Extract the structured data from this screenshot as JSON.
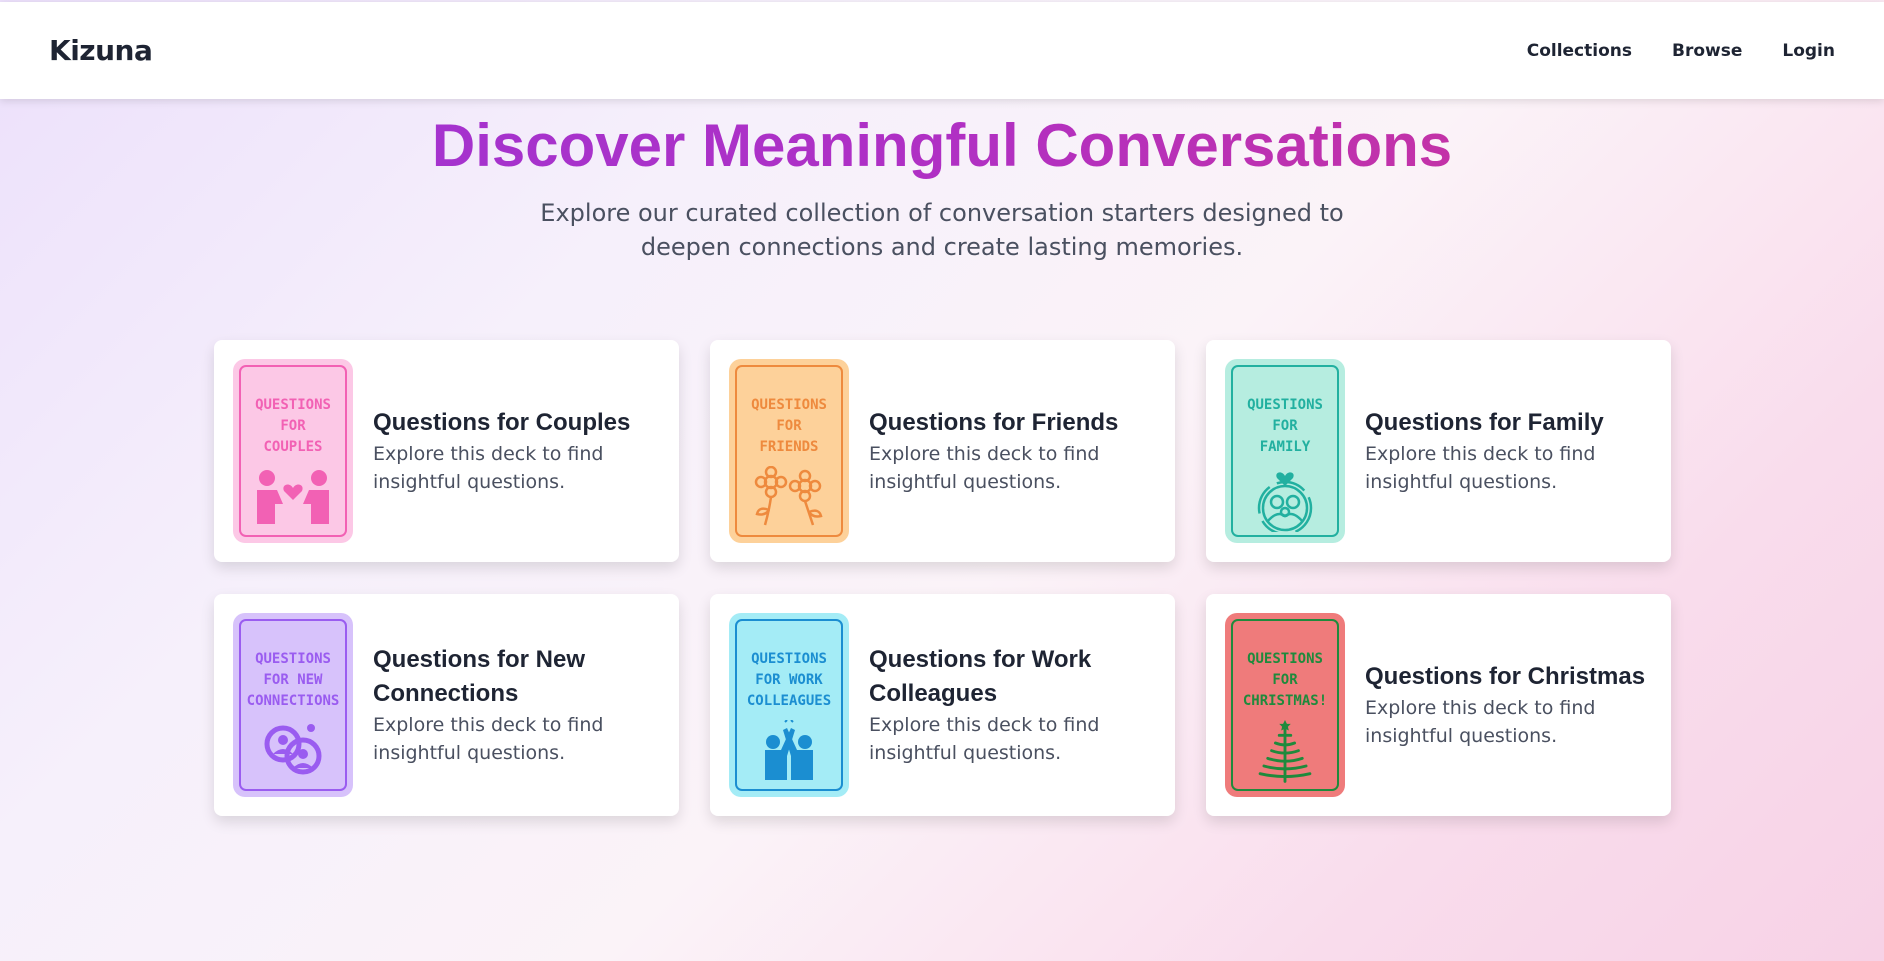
{
  "app": {
    "brand": "Kizuna"
  },
  "nav": {
    "collections": "Collections",
    "browse": "Browse",
    "login": "Login"
  },
  "hero": {
    "title": "Discover Meaningful Conversations",
    "subtitle_line1": "Explore our curated collection of conversation starters designed to",
    "subtitle_line2": "deepen connections and create lasting memories."
  },
  "decks": [
    {
      "title": "Questions for Couples",
      "desc_line1": "Explore this deck to find",
      "desc_line2": "insightful questions.",
      "cover_text": "Questions\nfor\ncouples",
      "icon": "couple-holding-heart-icon",
      "bg": "#fcc8e6",
      "ink": "#f261b4"
    },
    {
      "title": "Questions for Friends",
      "desc_line1": "Explore this deck to find",
      "desc_line2": "insightful questions.",
      "cover_text": "Questions\nfor\nfriends",
      "icon": "flower-friends-icon",
      "bg": "#fdd19a",
      "ink": "#ee8a3e"
    },
    {
      "title": "Questions for Family",
      "desc_line1": "Explore this deck to find",
      "desc_line2": "insightful questions.",
      "cover_text": "Questions\nfor\nfamily",
      "icon": "family-heart-icon",
      "bg": "#b6ede0",
      "ink": "#22b0a0"
    },
    {
      "title": "Questions for New Connections",
      "desc_line1": "Explore this deck to find",
      "desc_line2": "insightful questions.",
      "cover_text": "Questions\nfor new\nconnections",
      "icon": "linked-people-icon",
      "bg": "#d7c2fb",
      "ink": "#9a5cf0"
    },
    {
      "title": "Questions for Work Colleagues",
      "desc_line1": "Explore this deck to find",
      "desc_line2": "insightful questions.",
      "cover_text": "Questions\nfor work\ncolleagues",
      "icon": "high-five-icon",
      "bg": "#a4ecf6",
      "ink": "#1b8ed1"
    },
    {
      "title": "Questions for Christmas",
      "desc_line1": "Explore this deck to find",
      "desc_line2": "insightful questions.",
      "cover_text": "Questions\nfor\nchristmas!",
      "icon": "christmas-tree-icon",
      "bg": "#ef7b7b",
      "ink": "#1f8a3c"
    }
  ]
}
